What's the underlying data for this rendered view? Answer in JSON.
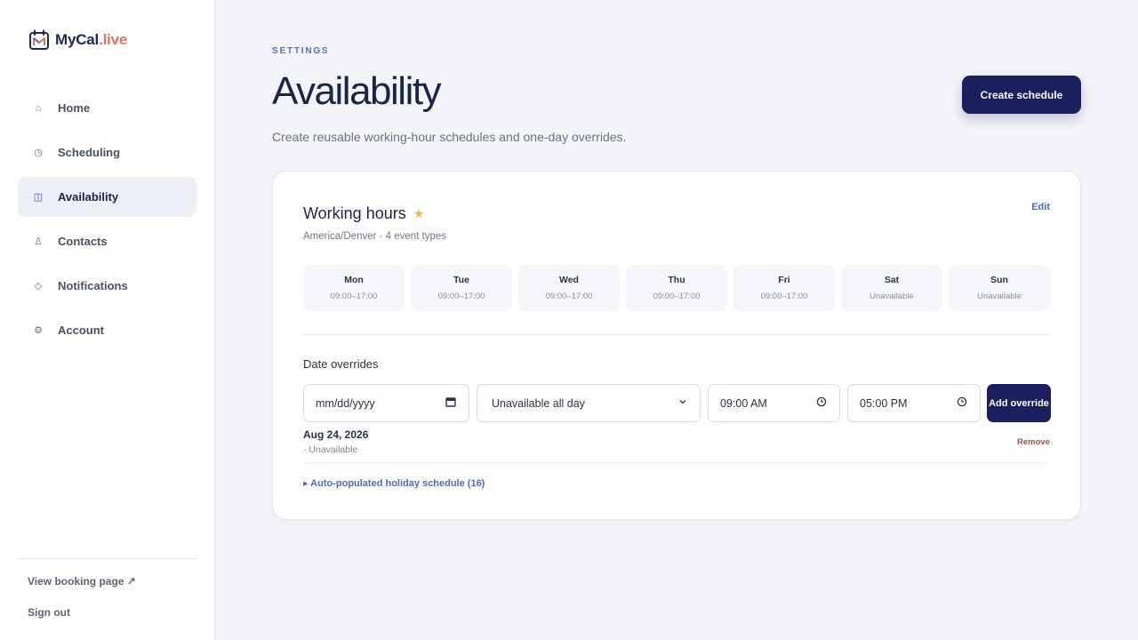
{
  "brand": {
    "name_main": "MyCal",
    "name_suffix": ".live"
  },
  "sidebar": {
    "items": [
      {
        "label": "Home",
        "icon": "home-icon",
        "glyph": "⌂",
        "active": false
      },
      {
        "label": "Scheduling",
        "icon": "clock-icon",
        "glyph": "◷",
        "active": false
      },
      {
        "label": "Availability",
        "icon": "columns-icon",
        "glyph": "◫",
        "active": true
      },
      {
        "label": "Contacts",
        "icon": "person-icon",
        "glyph": "♙",
        "active": false
      },
      {
        "label": "Notifications",
        "icon": "diamond-icon",
        "glyph": "◇",
        "active": false
      },
      {
        "label": "Account",
        "icon": "gear-icon",
        "glyph": "⚙",
        "active": false
      }
    ],
    "view_booking": "View booking page ↗",
    "sign_out": "Sign out"
  },
  "header": {
    "eyebrow": "SETTINGS",
    "title": "Availability",
    "subtitle": "Create reusable working-hour schedules and one-day overrides.",
    "create_button": "Create schedule"
  },
  "schedule": {
    "title": "Working hours",
    "meta": "America/Denver · 4 event types",
    "edit_label": "Edit",
    "days": [
      {
        "name": "Mon",
        "hours": "09:00–17:00"
      },
      {
        "name": "Tue",
        "hours": "09:00–17:00"
      },
      {
        "name": "Wed",
        "hours": "09:00–17:00"
      },
      {
        "name": "Thu",
        "hours": "09:00–17:00"
      },
      {
        "name": "Fri",
        "hours": "09:00–17:00"
      },
      {
        "name": "Sat",
        "hours": "Unavailable"
      },
      {
        "name": "Sun",
        "hours": "Unavailable"
      }
    ]
  },
  "overrides": {
    "label": "Date overrides",
    "date_placeholder": "mm/dd/yyyy",
    "select_value": "Unavailable all day",
    "start_time": "09:00 AM",
    "end_time": "05:00 PM",
    "add_button": "Add override",
    "entries": [
      {
        "date": "Aug 24, 2026",
        "status": "· Unavailable",
        "remove": "Remove"
      }
    ],
    "holiday_toggle": "▸ Auto-populated holiday schedule (16)"
  },
  "colors": {
    "accent": "#1c1f5e",
    "link": "#4d6cb8",
    "brand_accent": "#e4735c",
    "star": "#e9b84c",
    "remove": "#b24a3a"
  }
}
